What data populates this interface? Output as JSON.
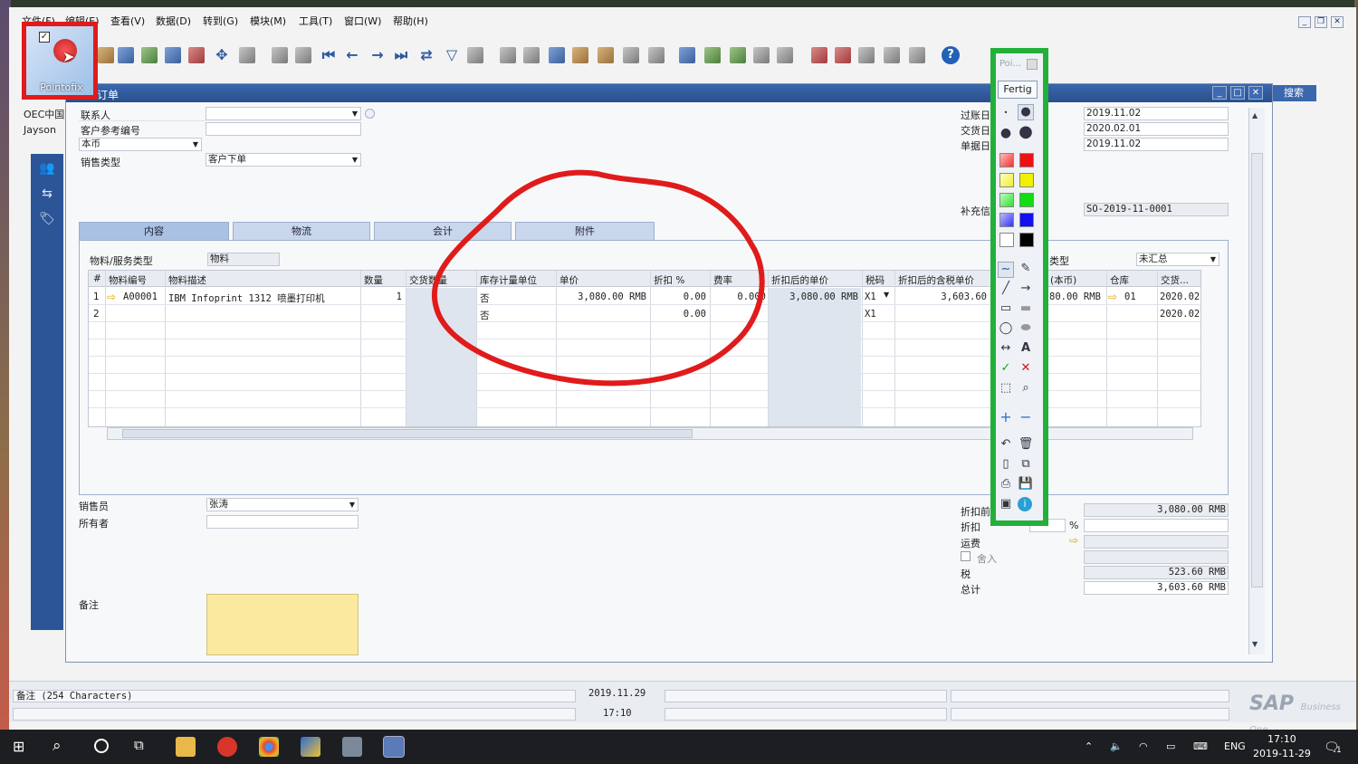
{
  "menu": [
    "文件(F)",
    "编辑(E)",
    "查看(V)",
    "数据(D)",
    "转到(G)",
    "模块(M)",
    "工具(T)",
    "窗口(W)",
    "帮助(H)"
  ],
  "pointofix": {
    "label": "Pointofix"
  },
  "side_info": {
    "company": "OEC中国",
    "user": "Jayson"
  },
  "form": {
    "title": "订单",
    "search_tab": "搜索",
    "header_left": {
      "contact_label": "联系人",
      "contact_value": "",
      "custref_label": "客户参考编号",
      "custref_value": "",
      "currency_value": "本币",
      "salestype_label": "销售类型",
      "salestype_value": "客户下单"
    },
    "header_right": {
      "posting_label": "过账日",
      "posting_value": "2019.11.02",
      "delivery_label": "交货日",
      "delivery_value": "2020.02.01",
      "docdate_label": "单据日",
      "docdate_value": "2019.11.02",
      "supp_label": "补充信",
      "supp_value": "SO-2019-11-0001"
    },
    "tabs": [
      "内容",
      "物流",
      "会计",
      "附件"
    ],
    "item_type_label": "物料/服务类型",
    "item_type_value": "物料",
    "summary_type_label": "类型",
    "summary_type_value": "未汇总",
    "columns": [
      "#",
      "物料编号",
      "物料描述",
      "数量",
      "交货数量",
      "库存计量单位",
      "单价",
      "折扣 %",
      "费率",
      "折扣后的单价",
      "税码",
      "折扣后的含税单价",
      "(本币)",
      "仓库",
      "交货..."
    ],
    "rows": [
      {
        "num": "1",
        "code": "A00001",
        "desc": "IBM Infoprint 1312 喷墨打印机",
        "qty": "1",
        "delqty": "",
        "inv_uom": "否",
        "price": "3,080.00 RMB",
        "disc": "0.00",
        "rate": "0.000",
        "price_after": "3,080.00 RMB",
        "tax": "X1",
        "gross": "3,603.60",
        "lc": "80.00 RMB",
        "wh": "01",
        "deliv": "2020.02."
      },
      {
        "num": "2",
        "code": "",
        "desc": "",
        "qty": "",
        "delqty": "",
        "inv_uom": "否",
        "price": "",
        "disc": "0.00",
        "rate": "",
        "price_after": "",
        "tax": "X1",
        "gross": "",
        "lc": "",
        "wh": "",
        "deliv": "2020.02."
      }
    ],
    "footer_left": {
      "salesperson_label": "销售员",
      "salesperson_value": "张涛",
      "owner_label": "所有者",
      "owner_value": "",
      "remarks_label": "备注"
    },
    "footer_right": {
      "before_disc_label": "折扣前",
      "before_disc_value": "3,080.00 RMB",
      "disc_label": "折扣",
      "disc_pct": "%",
      "disc_value": "",
      "freight_label": "运费",
      "freight_value": "",
      "rounding_label": "舍入",
      "rounding_value": "",
      "tax_label": "税",
      "tax_value": "523.60 RMB",
      "total_label": "总计",
      "total_value": "3,603.60 RMB"
    }
  },
  "statusbar": {
    "remarks": "备注 (254 Characters)",
    "date": "2019.11.29",
    "time": "17:10",
    "brand": "SAP",
    "brand_sub": "Business One"
  },
  "palette": {
    "title": "Poi...",
    "done": "Fertig"
  },
  "taskbar": {
    "lang": "ENG",
    "time": "17:10",
    "date": "2019-11-29",
    "notif": "1"
  },
  "colors": {
    "annotation": "#e01b1b",
    "palette_border": "#22b03a",
    "title_bar": "#2a4f8c"
  }
}
